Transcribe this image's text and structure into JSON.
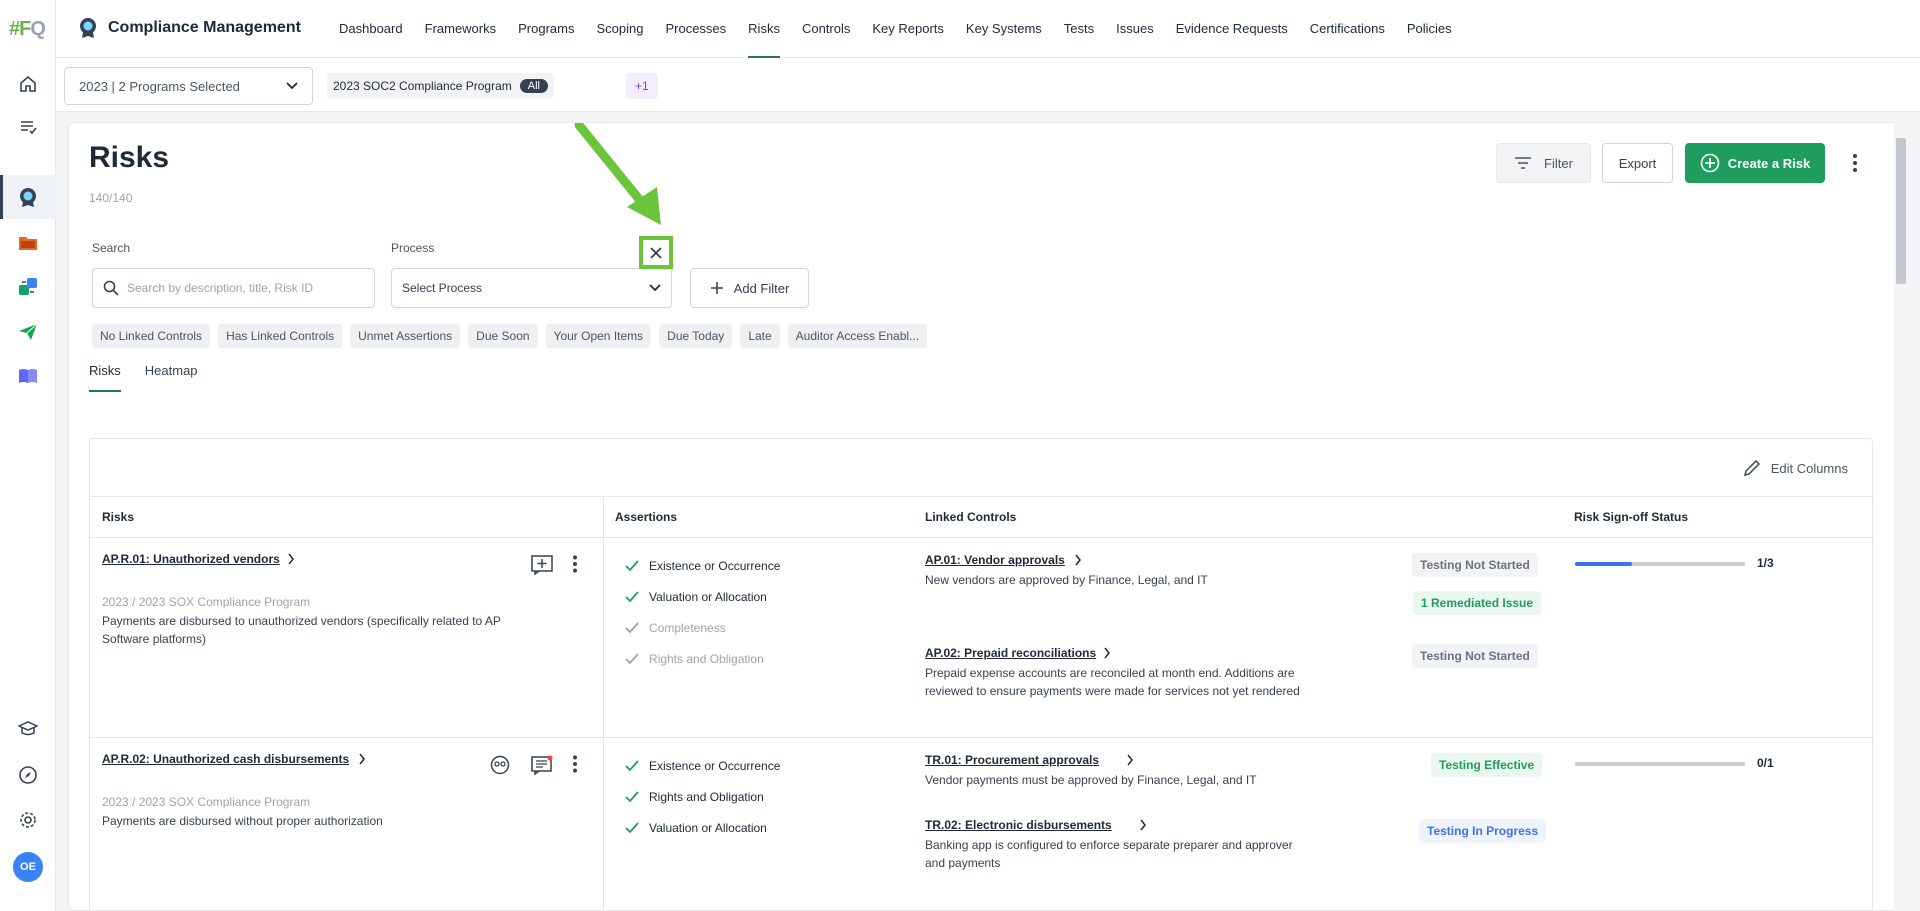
{
  "app": {
    "logo_main": "#F",
    "logo_sub": "Q",
    "title": "Compliance Management",
    "user_initials": "OE"
  },
  "nav": [
    "Dashboard",
    "Frameworks",
    "Programs",
    "Scoping",
    "Processes",
    "Risks",
    "Controls",
    "Key Reports",
    "Key Systems",
    "Tests",
    "Issues",
    "Evidence Requests",
    "Certifications",
    "Policies"
  ],
  "nav_active": "Risks",
  "subbar": {
    "program_selector": "2023 | 2 Programs Selected",
    "program_chip": "2023 SOC2 Compliance Program",
    "program_chip_badge": "All",
    "more_chip": "+1"
  },
  "page": {
    "title": "Risks",
    "count": "140/140",
    "filter_label": "Filter",
    "export_label": "Export",
    "create_label": "Create a Risk",
    "search_label": "Search",
    "search_placeholder": "Search by description, title, Risk ID",
    "process_label": "Process",
    "process_placeholder": "Select Process",
    "add_filter_label": "Add Filter",
    "quick_filters": [
      "No Linked Controls",
      "Has Linked Controls",
      "Unmet Assertions",
      "Due Soon",
      "Your Open Items",
      "Due Today",
      "Late",
      "Auditor Access Enabl..."
    ],
    "tabs": [
      "Risks",
      "Heatmap"
    ],
    "edit_columns": "Edit Columns"
  },
  "table": {
    "headers": [
      "Risks",
      "Assertions",
      "Linked Controls",
      "Risk Sign-off Status"
    ],
    "rows": [
      {
        "title": "AP.R.01: Unauthorized vendors",
        "program": "2023 / 2023 SOX Compliance Program",
        "description_1": "Payments are disbursed to unauthorized vendors (specifically related to AP",
        "description_2": "Software platforms)",
        "assertions": [
          {
            "label": "Existence or Occurrence",
            "met": true
          },
          {
            "label": "Valuation or Allocation",
            "met": true
          },
          {
            "label": "Completeness",
            "met": false
          },
          {
            "label": "Rights and Obligation",
            "met": false
          }
        ],
        "controls": [
          {
            "title": "AP.01: Vendor approvals",
            "desc_1": "New vendors are approved by Finance, Legal, and IT",
            "desc_2": "",
            "status": "Testing Not Started",
            "extra": "1 Remediated Issue"
          },
          {
            "title": "AP.02: Prepaid reconciliations",
            "desc_1": "Prepaid expense accounts are reconciled at month end. Additions are",
            "desc_2": "reviewed to ensure payments were made for services not yet rendered",
            "status": "Testing Not Started",
            "extra": ""
          }
        ],
        "signoff": "1/3",
        "signoff_fraction": 0.333
      },
      {
        "title": "AP.R.02: Unauthorized cash disbursements",
        "program": "2023 / 2023 SOX Compliance Program",
        "description_1": "Payments are disbursed without proper authorization",
        "description_2": "",
        "assertions": [
          {
            "label": "Existence or Occurrence",
            "met": true
          },
          {
            "label": "Rights and Obligation",
            "met": true
          },
          {
            "label": "Valuation or Allocation",
            "met": true
          }
        ],
        "controls": [
          {
            "title": "TR.01: Procurement approvals",
            "desc_1": "Vendor payments must be approved by Finance, Legal, and IT",
            "desc_2": "",
            "status": "Testing Effective",
            "extra": ""
          },
          {
            "title": "TR.02: Electronic disbursements",
            "desc_1": "Banking app is configured to enforce separate preparer and approver",
            "desc_2": "and payments",
            "status": "Testing In Progress",
            "extra": ""
          }
        ],
        "signoff": "0/1",
        "signoff_fraction": 0
      }
    ]
  },
  "colors": {
    "accent_green": "#1f9d5f",
    "annotation_green": "#6ac53c",
    "progress_blue": "#3b74e6"
  }
}
